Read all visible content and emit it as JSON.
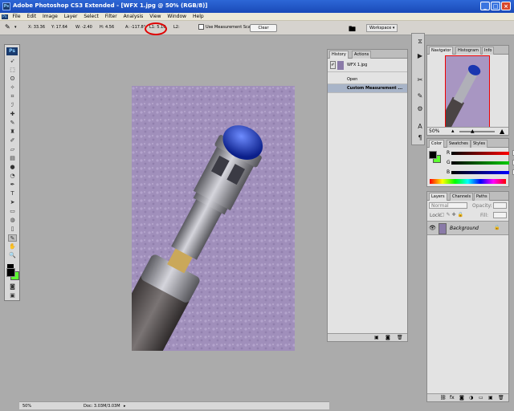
{
  "title_bar": {
    "app_badge": "Ps",
    "title": "Adobe Photoshop CS3 Extended - [WFX 1.jpg @ 50% (RGB/8)]",
    "minimize": "_",
    "maximize": "□",
    "close": "×"
  },
  "menu": {
    "file_icon": "Ps",
    "items": [
      "File",
      "Edit",
      "Image",
      "Layer",
      "Select",
      "Filter",
      "Analysis",
      "View",
      "Window",
      "Help"
    ]
  },
  "options_bar": {
    "x": "X: 33.36",
    "y": "Y: 17.64",
    "w": "W: -2.40",
    "h": "H: 4.56",
    "a": "A: -117.8°",
    "l1": "L1: 5.16",
    "l2": "L2:",
    "use_measurement_scale": "Use Measurement Scale",
    "clear": "Clear",
    "workspace": "Workspace ▾"
  },
  "toolbox": {
    "badge": "Ps"
  },
  "status_bar": {
    "zoom": "50%",
    "doc": "Doc: 3.03M/3.03M"
  },
  "history_panel": {
    "tabs": [
      "History",
      "Actions"
    ],
    "snapshot": "WFX 1.jpg",
    "states": [
      "Open",
      "Custom Measurement ..."
    ]
  },
  "navigator_panel": {
    "tabs": [
      "Navigator",
      "Histogram",
      "Info"
    ],
    "zoom": "50%"
  },
  "color_panel": {
    "tabs": [
      "Color",
      "Swatches",
      "Styles"
    ],
    "channels": [
      {
        "label": "R",
        "value": "0",
        "color": "#ff0000"
      },
      {
        "label": "G",
        "value": "0",
        "color": "#00cc00"
      },
      {
        "label": "B",
        "value": "0",
        "color": "#0000ff"
      }
    ]
  },
  "layers_panel": {
    "tabs": [
      "Layers",
      "Channels",
      "Paths"
    ],
    "blend_mode": "Normal",
    "opacity_label": "Opacity:",
    "lock_label": "Lock:",
    "fill_label": "Fill:",
    "layer_name": "Background"
  },
  "colors": {
    "foreground": "#000000",
    "background": "#5dff30"
  }
}
